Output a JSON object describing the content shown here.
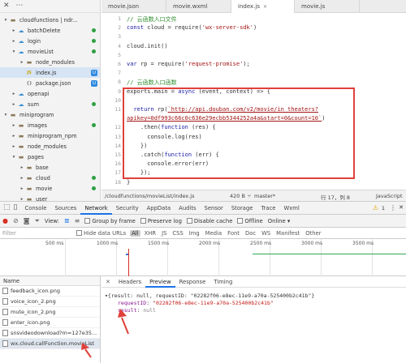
{
  "explorer": {
    "toolbar_icons": [
      "close-icon",
      "overflow-icon"
    ],
    "items": [
      {
        "label": "cloudfunctions | ndr...",
        "depth": 0,
        "arrow": "▾",
        "icon": "folder",
        "badge": "",
        "dot": ""
      },
      {
        "label": "batchDelete",
        "depth": 1,
        "arrow": "▸",
        "icon": "cloud",
        "badge": "",
        "dot": "#2ea043"
      },
      {
        "label": "login",
        "depth": 1,
        "arrow": "▸",
        "icon": "cloud",
        "badge": "",
        "dot": "#2ea043"
      },
      {
        "label": "movieList",
        "depth": 1,
        "arrow": "▾",
        "icon": "cloud",
        "badge": "",
        "dot": "#2ea043"
      },
      {
        "label": "node_modules",
        "depth": 2,
        "arrow": "▸",
        "icon": "folder",
        "badge": "",
        "dot": ""
      },
      {
        "label": "index.js",
        "depth": 2,
        "arrow": "",
        "icon": "js",
        "badge": "U",
        "dot": ""
      },
      {
        "label": "package.json",
        "depth": 2,
        "arrow": "",
        "icon": "json",
        "badge": "U",
        "dot": ""
      },
      {
        "label": "openapi",
        "depth": 1,
        "arrow": "▸",
        "icon": "cloud",
        "badge": "",
        "dot": ""
      },
      {
        "label": "sum",
        "depth": 1,
        "arrow": "▸",
        "icon": "cloud",
        "badge": "",
        "dot": "#2ea043"
      },
      {
        "label": "miniprogram",
        "depth": 0,
        "arrow": "▾",
        "icon": "folder",
        "badge": "",
        "dot": ""
      },
      {
        "label": "images",
        "depth": 1,
        "arrow": "▸",
        "icon": "folder",
        "badge": "",
        "dot": "#2ea043"
      },
      {
        "label": "miniprogram_npm",
        "depth": 1,
        "arrow": "▸",
        "icon": "folder",
        "badge": "",
        "dot": ""
      },
      {
        "label": "node_modules",
        "depth": 1,
        "arrow": "▸",
        "icon": "folder",
        "badge": "",
        "dot": ""
      },
      {
        "label": "pages",
        "depth": 1,
        "arrow": "▾",
        "icon": "folder",
        "badge": "",
        "dot": ""
      },
      {
        "label": "base",
        "depth": 2,
        "arrow": "▸",
        "icon": "folder",
        "badge": "",
        "dot": ""
      },
      {
        "label": "cloud",
        "depth": 2,
        "arrow": "▸",
        "icon": "folder",
        "badge": "",
        "dot": "#2ea043"
      },
      {
        "label": "movie",
        "depth": 2,
        "arrow": "▸",
        "icon": "folder",
        "badge": "",
        "dot": "#2ea043"
      },
      {
        "label": "user",
        "depth": 2,
        "arrow": "▸",
        "icon": "folder",
        "badge": "",
        "dot": ""
      }
    ]
  },
  "editor": {
    "tabs": [
      {
        "label": "movie.json",
        "active": false
      },
      {
        "label": "movie.wxml",
        "active": false
      },
      {
        "label": "index.js",
        "active": true
      },
      {
        "label": "movie.js",
        "active": false
      }
    ],
    "lines": [
      {
        "n": "1",
        "html": "<span class='c-com'>// 云函数入口文件</span>"
      },
      {
        "n": "2",
        "html": "<span class='c-kw'>const</span> cloud = require(<span class='c-str'>'wx-server-sdk'</span>)"
      },
      {
        "n": "3",
        "html": ""
      },
      {
        "n": "4",
        "html": "cloud.init()"
      },
      {
        "n": "5",
        "html": ""
      },
      {
        "n": "6",
        "html": "<span class='c-kw'>var</span> rp = require(<span class='c-str'>'request-promise'</span>);"
      },
      {
        "n": "7",
        "html": ""
      },
      {
        "n": "8",
        "html": "<span class='c-com'>// 云函数入口函数</span>"
      },
      {
        "n": "9",
        "html": "exports.main = <span class='c-kw'>async</span> (event, context) => {"
      },
      {
        "n": "10",
        "html": ""
      },
      {
        "n": "11",
        "html": "  <span class='c-kw'>return</span> rp(<span class='c-link'>`http://api.douban.com/v2/movie/in_theaters?</span>"
      },
      {
        "n": "",
        "html": "<span class='c-link'>apikey=0df993c66c0c636e29ecbb5344252a4a&amp;start=0&amp;count=10`</span>)"
      },
      {
        "n": "12",
        "html": "    .then(<span class='c-kw'>function</span> (res) {"
      },
      {
        "n": "13",
        "html": "      console.log(res)"
      },
      {
        "n": "14",
        "html": "    })"
      },
      {
        "n": "15",
        "html": "    .catch(<span class='c-kw'>function</span> (err) {"
      },
      {
        "n": "16",
        "html": "      console.error(err)"
      },
      {
        "n": "17",
        "html": "    });"
      },
      {
        "n": "18",
        "html": "}"
      }
    ],
    "status": {
      "path": "/cloudfunctions/movieList/index.js",
      "size": "420 B",
      "branch": "master*",
      "position": "行 17，列 8",
      "language": "JavaScript"
    }
  },
  "devtools": {
    "tabs": [
      "Console",
      "Sources",
      "Network",
      "Security",
      "AppData",
      "Audits",
      "Sensor",
      "Storage",
      "Trace",
      "Wxml"
    ],
    "active_tab": "Network",
    "warning_count": "1",
    "toolbar": {
      "view_label": "View:",
      "group_label": "Group by frame",
      "preserve_label": "Preserve log",
      "cache_label": "Disable cache",
      "offline_label": "Offline",
      "online_label": "Online"
    },
    "filter": {
      "placeholder": "Filter",
      "hide_label": "Hide data URLs",
      "types": [
        "All",
        "XHR",
        "JS",
        "CSS",
        "Img",
        "Media",
        "Font",
        "Doc",
        "WS",
        "Manifest",
        "Other"
      ],
      "active_type": "All"
    },
    "timeline_ticks": [
      "500 ms",
      "1000 ms",
      "1500 ms",
      "2000 ms",
      "2500 ms",
      "3000 ms",
      "3500 ms"
    ],
    "request_list": {
      "header": "Name",
      "rows": [
        {
          "name": "feedback_icon.png",
          "selected": false
        },
        {
          "name": "voice_icon_2.png",
          "selected": false
        },
        {
          "name": "mute_icon_2.png",
          "selected": false
        },
        {
          "name": "enter_icon.png",
          "selected": false
        },
        {
          "name": "snsvideodownload?m=127e35...",
          "selected": false
        },
        {
          "name": "wx.cloud.callFunction.movieList",
          "selected": true
        }
      ]
    },
    "detail": {
      "tabs": [
        "Headers",
        "Preview",
        "Response",
        "Timing"
      ],
      "active_tab": "Preview",
      "summary": "▾{result: null, requestID: \"02282f06-e8ec-11e9-a70a-525400b2c41b\"}",
      "request_id_key": "requestID",
      "request_id_val": "\"02282f06-e8ec-11e9-a70a-525400b2c41b\"",
      "result_key": "result",
      "result_val": "null"
    }
  }
}
